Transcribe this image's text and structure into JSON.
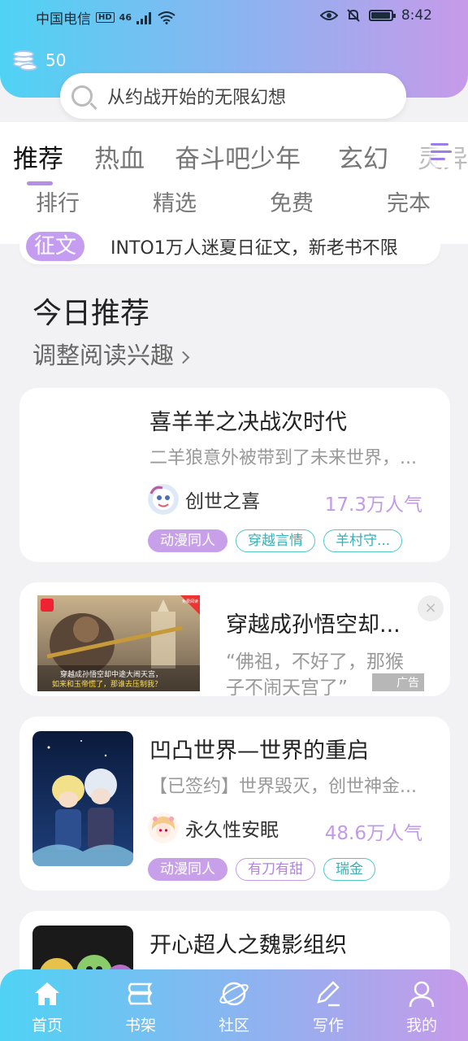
{
  "status_bar": {
    "carrier": "中国电信",
    "hd": "HD",
    "network": "46",
    "time": "8:42"
  },
  "coins": {
    "count": "50"
  },
  "search": {
    "placeholder": "从约战开始的无限幻想"
  },
  "tabs": [
    "推荐",
    "热血",
    "奋斗吧少年",
    "玄幻",
    "灵异"
  ],
  "subtabs": [
    "排行",
    "精选",
    "免费",
    "完本"
  ],
  "notice": {
    "badge": "征文",
    "text": "INTO1万人迷夏日征文，新老书不限"
  },
  "section": {
    "title": "今日推荐",
    "subtitle": "调整阅读兴趣"
  },
  "books": [
    {
      "title": "喜羊羊之决战次时代",
      "desc": "二羊狼意外被带到了未来世界，...",
      "author": "创世之喜",
      "popularity": "17.3万人气",
      "tags": [
        "动漫同人",
        "穿越言情",
        "羊村守..."
      ]
    },
    {
      "title": "凹凸世界—世界的重启",
      "desc": "【已签约】世界毁灭，创世神金...",
      "author": "永久性安眠",
      "popularity": "48.6万人气",
      "tags": [
        "动漫同人",
        "有刀有甜",
        "瑞金"
      ]
    },
    {
      "title": "开心超人之魏影组织"
    }
  ],
  "ad": {
    "title": "穿越成孙悟空却...",
    "desc": "“佛祖，不好了，那猴子不闹天宫了”",
    "label": "广告",
    "close": "×",
    "caption_1": "穿越成孙悟空却中途大闹天宫，",
    "caption_2": "如来和玉帝慌了，那谁去压制我？",
    "corner": "免费阅读"
  },
  "bottom_nav": [
    "首页",
    "书架",
    "社区",
    "写作",
    "我的"
  ],
  "colors": {
    "accent": "#c39ae6",
    "gradient_start": "#4fd3f4",
    "gradient_end": "#c79ae9",
    "teal": "#4fc7cc"
  }
}
